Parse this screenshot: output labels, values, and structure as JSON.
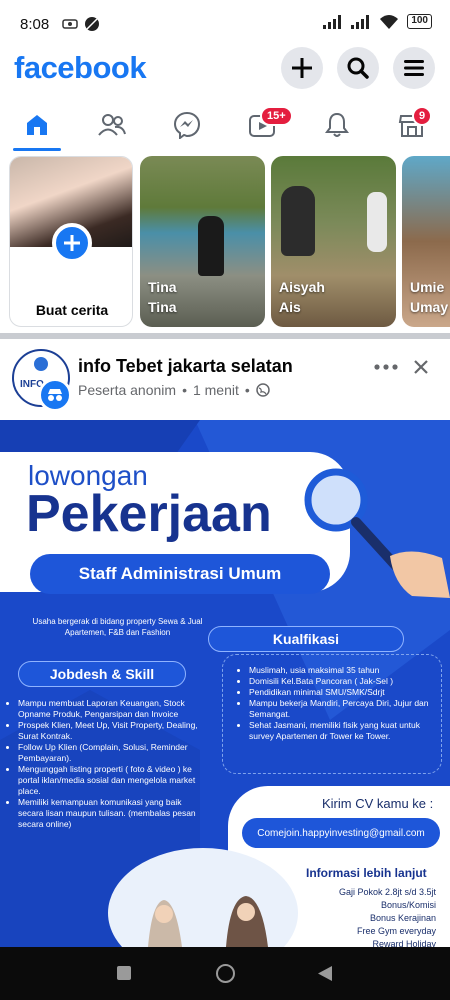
{
  "status_bar": {
    "time": "8:08",
    "battery": "100"
  },
  "header": {
    "logo": "facebook",
    "icons": [
      "plus-icon",
      "search-icon",
      "menu-icon"
    ]
  },
  "tabs": [
    {
      "name": "home",
      "icon": "home-icon",
      "active": true
    },
    {
      "name": "friends",
      "icon": "friends-icon"
    },
    {
      "name": "messenger",
      "icon": "messenger-icon"
    },
    {
      "name": "video",
      "icon": "video-icon",
      "badge": "15+"
    },
    {
      "name": "notifications",
      "icon": "bell-icon"
    },
    {
      "name": "marketplace",
      "icon": "marketplace-icon",
      "badge": "9"
    }
  ],
  "stories": {
    "create_label": "Buat cerita",
    "items": [
      {
        "name_line1": "Tina",
        "name_line2": "Tina"
      },
      {
        "name_line1": "Aisyah",
        "name_line2": "Ais"
      },
      {
        "name_line1": "Umie",
        "name_line2": "Umay"
      }
    ]
  },
  "post": {
    "group": "info Tebet jakarta selatan",
    "author": "Peserta anonim",
    "separator": "•",
    "time": "1 menit",
    "avatar_text": "INFO",
    "ad": {
      "headline_small": "lowongan",
      "headline_big": "Pekerjaan",
      "position": "Staff Administrasi Umum",
      "company_desc": "Usaha bergerak di bidang property  Sewa & Jual Apartemen, F&B dan Fashion",
      "jobdesk_title": "Jobdesh & Skill",
      "jobdesk": [
        "Mampu membuat Laporan Keuangan, Stock Opname Produk, Pengarsipan dan Invoice",
        "Prospek Klien, Meet Up, Visit Property, Dealing, Surat Kontrak.",
        "Follow Up Klien (Complain, Solusi, Reminder Pembayaran).",
        "Mengunggah listing properti ( foto & video ) ke portal iklan/media sosial dan mengelola market place.",
        "Memiliki kemampuan komunikasi yang baik secara lisan maupun tulisan.  (membalas pesan secara online)"
      ],
      "kualifikasi_title": "Kualfikasi",
      "kualifikasi": [
        "Muslimah, usia maksimal 35 tahun",
        "Domisili Kel.Bata Pancoran ( Jak-Sel )",
        "Pendidikan minimal SMU/SMK/Sdrjt",
        "Mampu bekerja Mandiri, Percaya Diri, Jujur dan Semangat.",
        "Sehat Jasmani, memiliki fisik yang kuat untuk survey Apartemen dr Tower ke Tower."
      ],
      "cv_label": "Kirim CV kamu ke :",
      "email": "Comejoin.happyinvesting@gmail.com",
      "info_title": "Informasi lebih lanjut",
      "benefits": [
        "Gaji Pokok 2.8jt s/d 3.5jt",
        "Bonus/Komisi",
        "Bonus Kerajinan",
        "Free Gym everyday",
        "Reward Holiday"
      ]
    }
  },
  "colors": {
    "brand": "#1877f2",
    "ad_blue": "#1a49c9",
    "ad_dark": "#123aa8",
    "badge": "#e41e3f"
  }
}
